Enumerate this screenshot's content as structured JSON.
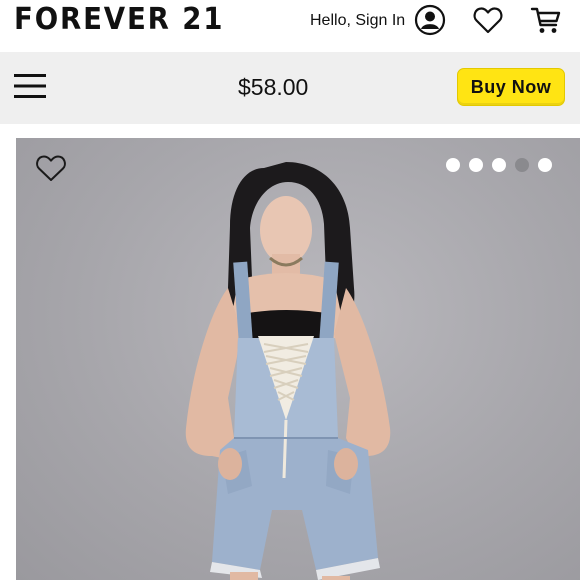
{
  "header": {
    "logo_text": "FOREVER 21",
    "greeting": "Hello, Sign In",
    "icons": [
      "account-icon",
      "heart-icon",
      "cart-icon"
    ]
  },
  "sticky_bar": {
    "menu_icon": "menu-icon",
    "price": "$58.00",
    "buy_label": "Buy Now",
    "buy_color": "#ffe413"
  },
  "gallery": {
    "wishlist_icon": "heart-outline-icon",
    "image_alt": "Model wearing denim overall shorts with lace-up front",
    "dots_total": 5,
    "active_dot": 4
  }
}
